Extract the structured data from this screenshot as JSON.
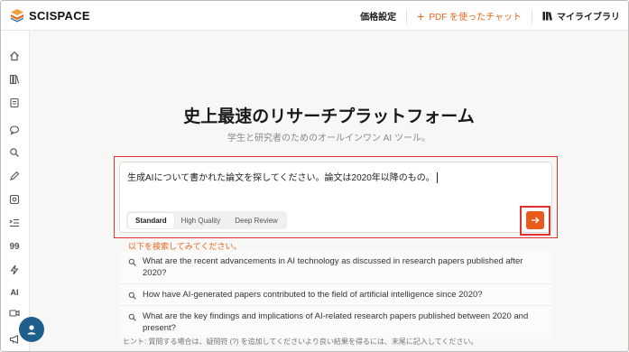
{
  "app": {
    "brand": "SCISPACE",
    "brand_colors": {
      "orange": "#e8661f",
      "blue": "#1f5f8b",
      "highlight": "#e0322e"
    }
  },
  "topnav": {
    "pricing": "価格設定",
    "pdf_chat": "PDF を使ったチャット",
    "library": "マイライブラリ"
  },
  "sidebar": {
    "icons": [
      "home-icon",
      "library-icon",
      "notebook-icon",
      "chat-icon",
      "search-icon",
      "pen-icon",
      "extract-icon",
      "list-indent-icon",
      "quote-icon",
      "bolt-icon",
      "ai-detector-icon",
      "video-icon",
      "megaphone-icon"
    ],
    "ai_label": "AI",
    "quote_label": "99"
  },
  "main": {
    "heading": "史上最速のリサーチプラットフォーム",
    "subheading": "学生と研究者のためのオールインワン AI ツール。",
    "search": {
      "value": "生成AIについて書かれた論文を探してください。論文は2020年以降のもの。",
      "modes": [
        "Standard",
        "High Quality",
        "Deep Review"
      ],
      "active_mode": "Standard"
    },
    "suggest_label": "以下を検索してみてください。",
    "suggestions": [
      "What are the recent advancements in AI technology as discussed in research papers published after 2020?",
      "How have AI-generated papers contributed to the field of artificial intelligence since 2020?",
      "What are the key findings and implications of AI-related research papers published between 2020 and present?"
    ],
    "hint": "ヒント: 質問する場合は、疑問符 (?) を追加してくださいより良い結果を得るには、末尾に記入してください。"
  }
}
